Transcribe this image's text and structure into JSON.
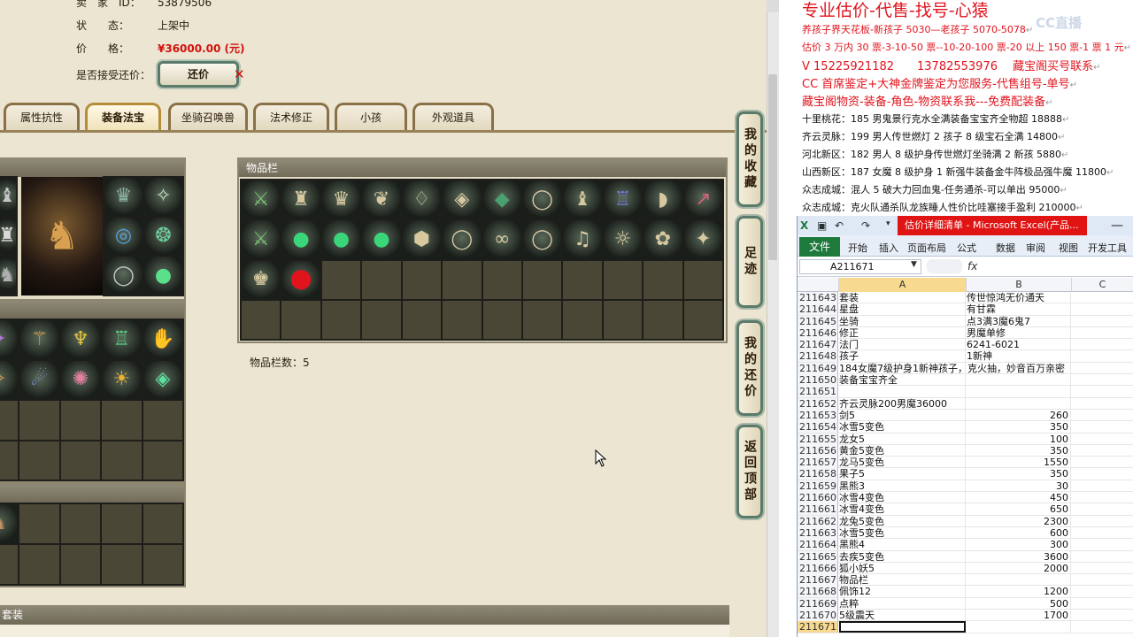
{
  "game": {
    "info": {
      "seller_label": "卖　家　ID：",
      "seller_value": "53879506",
      "status_label": "状　　态：",
      "status_value": "上架中",
      "price_label": "价　　格：",
      "price_value": "¥36000.00 (元)",
      "counter_label": "是否接受还价：",
      "counter_button": "还价",
      "counter_x": "✕"
    },
    "tabs": [
      "属性抗性",
      "装备法宝",
      "坐骑召唤兽",
      "法术修正",
      "小孩",
      "外观道具"
    ],
    "active_tab": 1,
    "inventory_title": "物品栏",
    "inventory_count": "物品栏数：5",
    "bottom_bar_label": "套装",
    "side_buttons": [
      "我的收藏",
      "足迹",
      "我的还价",
      "返回顶部"
    ],
    "inventory_item_icons": [
      "sword-icon",
      "armor-icon",
      "helmet-icon",
      "necklace-icon",
      "charm-icon",
      "belt-icon",
      "gem-icon",
      "ring-icon",
      "boots-icon",
      "robe-icon",
      "shoulder-icon",
      "spear-icon",
      "sword-icon",
      "orb-icon",
      "orb-icon",
      "orb-icon",
      "stone-icon",
      "ring-icon",
      "rope-icon",
      "ring-icon",
      "bell-icon",
      "amulet-icon",
      "flower-icon",
      "claw-icon",
      "crown-icon",
      "ruby-icon"
    ]
  },
  "notes": {
    "headline": "专业估价-代售-找号-心猿",
    "watermark": "CC直播",
    "lines": [
      {
        "text": "养孩子界天花板-新孩子 5030—老孩子 5070-5078",
        "style": "red"
      },
      {
        "text": "估价 3 万内 30 票-3-10-50 票--10-20-100 票-20 以上 150 票-1 票 1 元",
        "style": "red"
      },
      {
        "text": "V 15225921182　　13782553976　 藏宝阁买号联系",
        "style": "red-med"
      },
      {
        "text": "CC 首席鉴定+大神金牌鉴定为您服务-代售组号-单号",
        "style": "red-med"
      },
      {
        "text": "藏宝阁物资-装备-角色-物资联系我---免费配装备",
        "style": "red-med"
      },
      {
        "text": "十里桃花：185 男鬼景行克水全满装备宝宝齐全物超 18888",
        "style": "blk"
      },
      {
        "text": "齐云灵脉：199 男人传世燃灯 2 孩子 8 级宝石全满 14800",
        "style": "blk"
      },
      {
        "text": "河北新区：182 男人 8 级护身传世燃灯坐骑满 2 新孩 5880",
        "style": "blk"
      },
      {
        "text": "山西新区：187 女魔 8 级护身 1 新强牛装备金牛阵极品强牛魔 11800",
        "style": "blk"
      },
      {
        "text": "众志成城：混人 5 破大力回血鬼-任务通杀-可以单出 95000",
        "style": "blk"
      },
      {
        "text": "众志成城：克火队通杀队龙族睡人性价比哇塞接手盈利 210000",
        "style": "blk"
      }
    ],
    "pilcrow": "↵"
  },
  "excel": {
    "title": "估价详细清单 - Microsoft Excel(产品...",
    "file_tab": "文件",
    "ribbon_tabs": [
      "开始",
      "插入",
      "页面布局",
      "公式",
      "数据",
      "审阅",
      "视图",
      "开发工具"
    ],
    "name_box": "A211671",
    "fx": "fx",
    "columns": [
      "A",
      "B",
      "C"
    ],
    "rows": [
      {
        "n": "211643",
        "a": "套装",
        "b": "传世惊鸿无价通天",
        "num": false
      },
      {
        "n": "211644",
        "a": "星盘",
        "b": "有甘霖",
        "num": false
      },
      {
        "n": "211645",
        "a": "坐骑",
        "b": "点3满3魔6鬼7",
        "num": false
      },
      {
        "n": "211646",
        "a": "修正",
        "b": "男魔单修",
        "num": false
      },
      {
        "n": "211647",
        "a": "法门",
        "b": "6241-6021",
        "num": false
      },
      {
        "n": "211648",
        "a": "孩子",
        "b": "1新神",
        "num": false
      },
      {
        "n": "211649",
        "a": "184女魔7级护身1新神孩子，克火抽，妙音百万亲密",
        "b": "",
        "num": false
      },
      {
        "n": "211650",
        "a": "装备宝宝齐全",
        "b": "",
        "num": false
      },
      {
        "n": "211651",
        "a": "",
        "b": "",
        "num": false
      },
      {
        "n": "211652",
        "a": "齐云灵脉200男魔36000",
        "b": "",
        "num": false
      },
      {
        "n": "211653",
        "a": "剑5",
        "b": "260",
        "num": true
      },
      {
        "n": "211654",
        "a": "冰雪5变色",
        "b": "350",
        "num": true
      },
      {
        "n": "211655",
        "a": "龙女5",
        "b": "100",
        "num": true
      },
      {
        "n": "211656",
        "a": "黄金5变色",
        "b": "350",
        "num": true
      },
      {
        "n": "211657",
        "a": "龙马5变色",
        "b": "1550",
        "num": true
      },
      {
        "n": "211658",
        "a": "果子5",
        "b": "350",
        "num": true
      },
      {
        "n": "211659",
        "a": "黑熊3",
        "b": "30",
        "num": true
      },
      {
        "n": "211660",
        "a": "冰雪4变色",
        "b": "450",
        "num": true
      },
      {
        "n": "211661",
        "a": "冰雪4变色",
        "b": "650",
        "num": true
      },
      {
        "n": "211662",
        "a": "龙兔5变色",
        "b": "2300",
        "num": true
      },
      {
        "n": "211663",
        "a": "冰雪5变色",
        "b": "600",
        "num": true
      },
      {
        "n": "211664",
        "a": "黑熊4",
        "b": "300",
        "num": true
      },
      {
        "n": "211665",
        "a": "去疾5变色",
        "b": "3600",
        "num": true
      },
      {
        "n": "211666",
        "a": "狐小妖5",
        "b": "2000",
        "num": true
      },
      {
        "n": "211667",
        "a": "物品栏",
        "b": "",
        "num": false
      },
      {
        "n": "211668",
        "a": "佩饰12",
        "b": "1200",
        "num": true
      },
      {
        "n": "211669",
        "a": "点粹",
        "b": "500",
        "num": true
      },
      {
        "n": "211670",
        "a": "5级震天",
        "b": "1700",
        "num": true
      },
      {
        "n": "211671",
        "a": "",
        "b": "",
        "num": false
      }
    ]
  }
}
